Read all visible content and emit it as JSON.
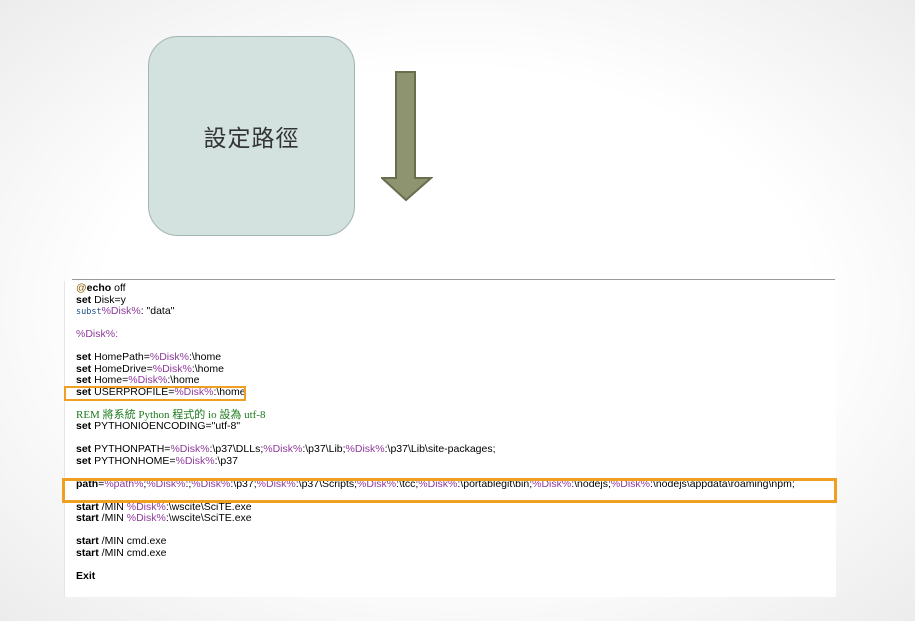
{
  "slide": {
    "step_label": "設定路徑",
    "arrow_icon": "down-arrow-icon",
    "colors": {
      "box_fill": "#d3e1df",
      "arrow_fill": "#8f9470",
      "highlight": "#f0a020"
    }
  },
  "code": {
    "l1": {
      "at": "@",
      "kw": "echo",
      "rest": " off"
    },
    "l2": {
      "kw": "set",
      "rest": " Disk=y"
    },
    "l3": {
      "kw": "subst",
      "var": "%Disk%",
      "rest": ": \"data\""
    },
    "l4": {
      "var": "%Disk%",
      "rest": ":"
    },
    "l5": {
      "kw": "set",
      "a": " HomePath=",
      "var": "%Disk%",
      "b": ":\\home"
    },
    "l6": {
      "kw": "set",
      "a": " HomeDrive=",
      "var": "%Disk%",
      "b": ":\\home"
    },
    "l7": {
      "kw": "set",
      "a": " Home=",
      "var": "%Disk%",
      "b": ":\\home"
    },
    "l8": {
      "kw": "set",
      "a": " USERPROFILE=",
      "var": "%Disk%",
      "b": ":\\home"
    },
    "l9": {
      "rem": "REM 將系統 Python 程式的 io 設為 utf-8"
    },
    "l10": {
      "kw": "set",
      "rest": " PYTHONIOENCODING=\"utf-8\""
    },
    "l11": {
      "kw": "set",
      "a": " PYTHONPATH=",
      "v1": "%Disk%",
      "b": ":\\p37\\DLLs;",
      "v2": "%Disk%",
      "c": ":\\p37\\Lib;",
      "v3": "%Disk%",
      "d": ":\\p37\\Lib\\site-packages;"
    },
    "l12": {
      "kw": "set",
      "a": " PYTHONHOME=",
      "var": "%Disk%",
      "b": ":\\p37"
    },
    "l13": {
      "kw": "path",
      "a": "=",
      "v0": "%path%",
      "b": ";",
      "v1": "%Disk%",
      "c": ":;",
      "v2": "%Disk%",
      "d": ":\\p37;",
      "v3": "%Disk%",
      "e": ":\\p37\\Scripts;",
      "v4": "%Disk%",
      "f": ":\\tcc;",
      "v5": "%Disk%",
      "g": ":\\portablegit\\bin;",
      "v6": "%Disk%",
      "h": ":\\nodejs;",
      "v7": "%Disk%",
      "i": ":\\nodejs\\appdata\\roaming\\npm;"
    },
    "l14": {
      "kw": "start",
      "a": " /MIN ",
      "var": "%Disk%",
      "b": ":\\wscite\\SciTE.exe"
    },
    "l15": {
      "kw": "start",
      "a": " /MIN ",
      "var": "%Disk%",
      "b": ":\\wscite\\SciTE.exe"
    },
    "l16": {
      "kw": "start",
      "rest": " /MIN cmd.exe"
    },
    "l17": {
      "kw": "start",
      "rest": " /MIN cmd.exe"
    },
    "l18": {
      "kw": "Exit"
    }
  }
}
